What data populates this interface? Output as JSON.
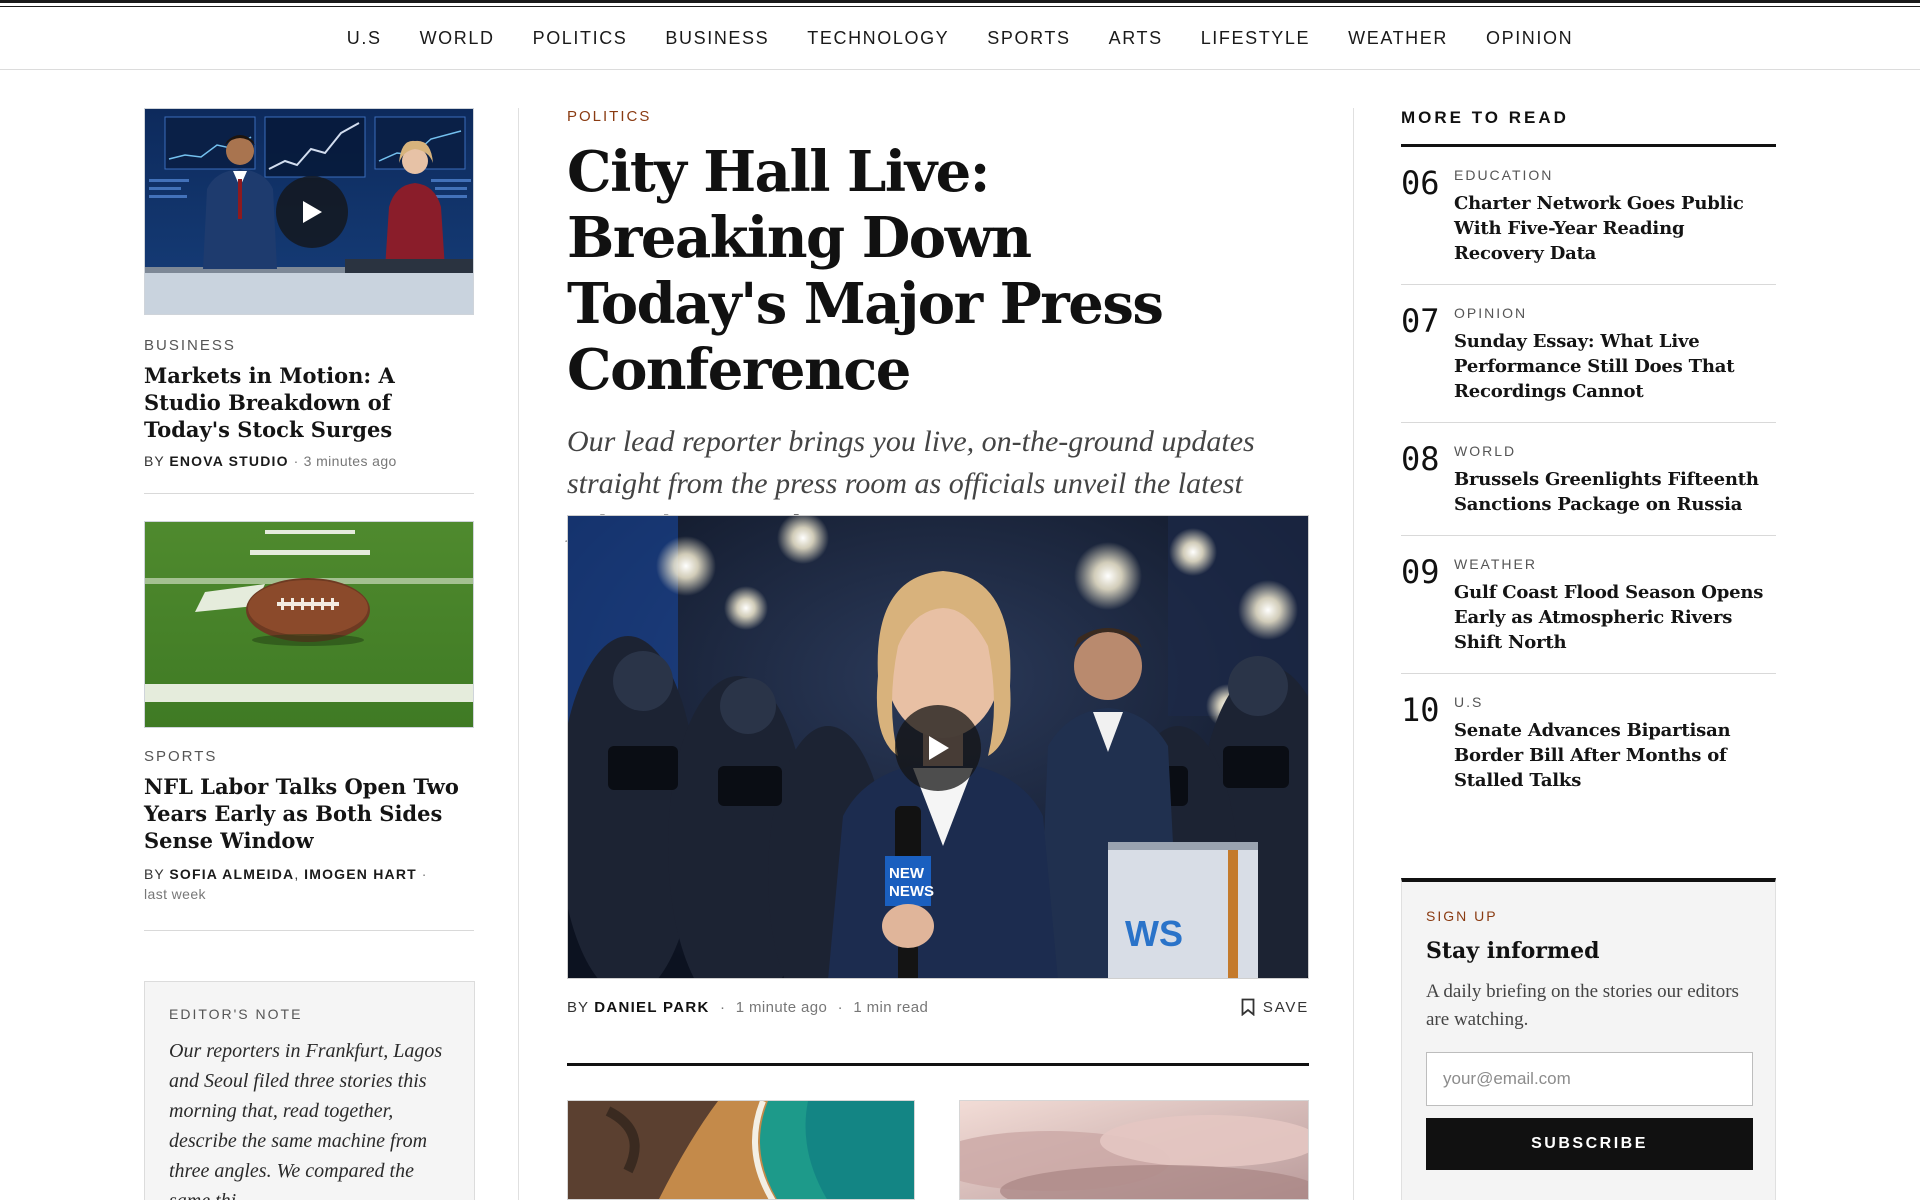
{
  "nav": [
    "U.S",
    "WORLD",
    "POLITICS",
    "BUSINESS",
    "TECHNOLOGY",
    "SPORTS",
    "ARTS",
    "LIFESTYLE",
    "WEATHER",
    "OPINION"
  ],
  "left": {
    "story1": {
      "kicker": "BUSINESS",
      "headline": "Markets in Motion: A Studio Breakdown of Today's Stock Surges",
      "by": "BY",
      "author": "ENOVA STUDIO",
      "dot": "·",
      "time": "3 minutes ago"
    },
    "story2": {
      "kicker": "SPORTS",
      "headline": "NFL Labor Talks Open Two Years Early as Both Sides Sense Window",
      "by": "BY",
      "author1": "SOFIA ALMEIDA",
      "comma": ",",
      "author2": "IMOGEN HART",
      "dot": "·",
      "time": "last week"
    },
    "note": {
      "kicker": "EDITOR'S NOTE",
      "text": "Our reporters in Frankfurt, Lagos and Seoul filed three stories this morning that, read together, describe the same machine from three angles. We compared the same thi"
    }
  },
  "center": {
    "kicker": "POLITICS",
    "headline": "City Hall Live: Breaking Down Today's Major Press Conference",
    "dek": "Our lead reporter brings you live, on-the-ground updates straight from the press room as officials unveil the latest policy changes and community initiatives.",
    "mic_label_1": "NEW",
    "mic_label_2": "NEWS",
    "podium_text": "WS",
    "by": "BY",
    "author": "DANIEL PARK",
    "dot": "·",
    "time": "1 minute ago",
    "read": "1 min read",
    "save_label": "SAVE"
  },
  "right": {
    "title": "MORE TO READ",
    "items": [
      {
        "num": "06",
        "kicker": "EDUCATION",
        "headline": "Charter Network Goes Public With Five-Year Reading Recovery Data"
      },
      {
        "num": "07",
        "kicker": "OPINION",
        "headline": "Sunday Essay: What Live Performance Still Does That Recordings Cannot"
      },
      {
        "num": "08",
        "kicker": "WORLD",
        "headline": "Brussels Greenlights Fifteenth Sanctions Package on Russia"
      },
      {
        "num": "09",
        "kicker": "WEATHER",
        "headline": "Gulf Coast Flood Season Opens Early as Atmospheric Rivers Shift North"
      },
      {
        "num": "10",
        "kicker": "U.S",
        "headline": "Senate Advances Bipartisan Border Bill After Months of Stalled Talks"
      }
    ],
    "signup": {
      "kicker": "SIGN UP",
      "title": "Stay informed",
      "text": "A daily briefing on the stories our editors are watching.",
      "placeholder": "your@email.com",
      "button": "SUBSCRIBE"
    }
  },
  "colors": {
    "accent": "#8a3b12",
    "ink": "#111111",
    "rule": "#d9d9d9"
  }
}
